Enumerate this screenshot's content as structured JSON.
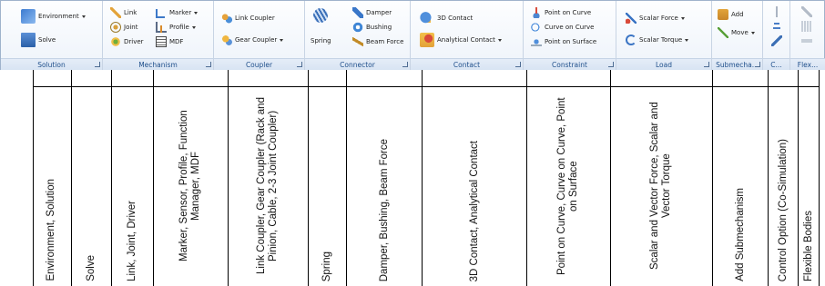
{
  "ribbon": {
    "groups": [
      {
        "label": "Solution",
        "buttons": [
          {
            "label": "Environment",
            "icon": "environment-icon",
            "dropdown": true
          },
          {
            "label": "Solve",
            "icon": "solve-icon"
          }
        ]
      },
      {
        "label": "Mechanism",
        "buttons": [
          {
            "label": "Link",
            "icon": "link-icon"
          },
          {
            "label": "Joint",
            "icon": "joint-icon"
          },
          {
            "label": "Driver",
            "icon": "driver-icon"
          },
          {
            "label": "Marker",
            "icon": "marker-icon",
            "dropdown": true
          },
          {
            "label": "Profile",
            "icon": "profile-icon",
            "dropdown": true
          },
          {
            "label": "MDF",
            "icon": "mdf-icon"
          }
        ]
      },
      {
        "label": "Coupler",
        "buttons": [
          {
            "label": "Link Coupler",
            "icon": "link-coupler-icon"
          },
          {
            "label": "Gear Coupler",
            "icon": "gear-coupler-icon",
            "dropdown": true
          }
        ]
      },
      {
        "label": "Connector",
        "buttons": [
          {
            "label": "Spring",
            "icon": "spring-icon"
          },
          {
            "label": "Damper",
            "icon": "damper-icon"
          },
          {
            "label": "Bushing",
            "icon": "bushing-icon"
          },
          {
            "label": "Beam Force",
            "icon": "beam-force-icon"
          }
        ]
      },
      {
        "label": "Contact",
        "buttons": [
          {
            "label": "3D Contact",
            "icon": "3d-contact-icon"
          },
          {
            "label": "Analytical Contact",
            "icon": "analytical-contact-icon",
            "dropdown": true
          }
        ]
      },
      {
        "label": "Constraint",
        "buttons": [
          {
            "label": "Point on Curve",
            "icon": "point-on-curve-icon"
          },
          {
            "label": "Curve on Curve",
            "icon": "curve-on-curve-icon"
          },
          {
            "label": "Point on Surface",
            "icon": "point-on-surface-icon"
          }
        ]
      },
      {
        "label": "Load",
        "buttons": [
          {
            "label": "Scalar Force",
            "icon": "scalar-force-icon",
            "dropdown": true
          },
          {
            "label": "Scalar Torque",
            "icon": "scalar-torque-icon",
            "dropdown": true
          }
        ]
      },
      {
        "label": "Submecha...",
        "buttons": [
          {
            "label": "Add",
            "icon": "add-icon"
          },
          {
            "label": "Move",
            "icon": "move-icon",
            "dropdown": true
          }
        ]
      },
      {
        "label": "C...",
        "buttons": []
      },
      {
        "label": "Flex...",
        "buttons": []
      }
    ]
  },
  "annotations": [
    "Environment, Solution",
    "Solve",
    "Link, Joint, Driver",
    "Marker, Sensor, Profile, Function Manager, MDF",
    "Link Coupler, Gear Coupler (Rack and Pinion, Cable, 2-3 Joint Coupler)",
    "Spring",
    "Damper, Bushing, Beam Force",
    "3D Contact, Analytical Contact",
    "Point on Curve, Curve on Curve, Point on Surface",
    "Scalar and Vector Force, Scalar and Vector Torque",
    "Add Submechanism",
    "Control Option (Co-Simulation)",
    "Flexible Bodies"
  ]
}
